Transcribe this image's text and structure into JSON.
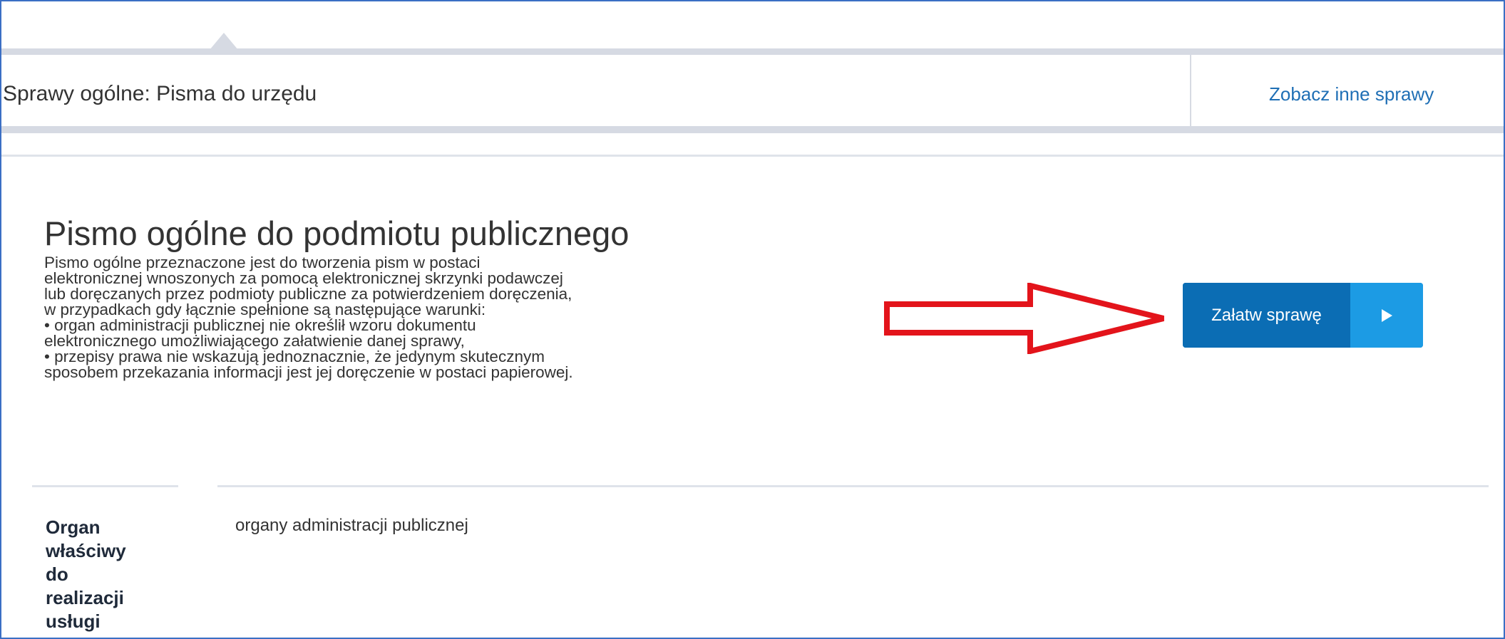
{
  "header": {
    "title": "Sprawy ogólne: Pisma do urzędu",
    "other_cases_link": "Zobacz inne sprawy"
  },
  "service": {
    "title": "Pismo ogólne do podmiotu publicznego",
    "description_lines": [
      "Pismo ogólne przeznaczone jest do tworzenia pism w postaci",
      "elektronicznej wnoszonych za pomocą elektronicznej skrzynki podawczej",
      "lub doręczanych przez podmioty publiczne za potwierdzeniem doręczenia,",
      "w przypadkach gdy łącznie spełnione są następujące warunki:",
      "• organ administracji publicznej nie określił wzoru dokumentu",
      "elektronicznego umożliwiającego załatwienie danej sprawy,",
      "• przepisy prawa nie wskazują jednoznacznie, że jedynym skutecznym",
      "sposobem przekazania informacji jest jej doręczenie w postaci papierowej."
    ],
    "action_button_label": "Załatw sprawę",
    "action_button_icon": "play-icon"
  },
  "details": {
    "organ_label_lines": [
      "Organ",
      "właściwy",
      "do",
      "realizacji",
      "usługi"
    ],
    "organ_value": "organy administracji publicznej"
  },
  "annotation": {
    "arrow_icon": "red-arrow-icon",
    "arrow_color": "#e3141b"
  },
  "colors": {
    "button_primary": "#0b6db4",
    "button_secondary": "#1c9be4",
    "link": "#1f6fb5",
    "frame_border": "#3b6fc4"
  }
}
